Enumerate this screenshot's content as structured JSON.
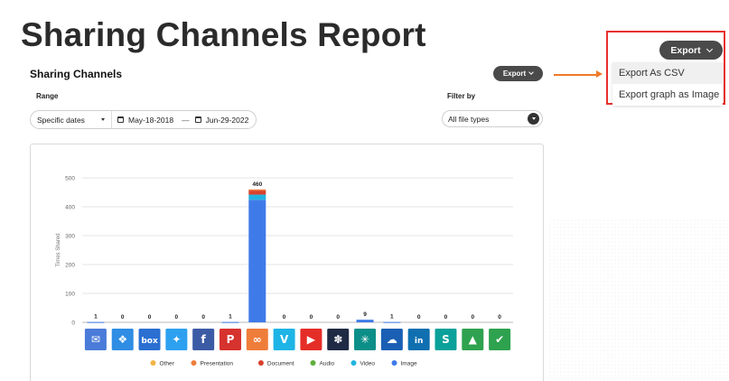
{
  "slide_title": "Sharing Channels Report",
  "panel": {
    "title": "Sharing Channels",
    "export_label": "Export",
    "range_label": "Range",
    "filter_label": "Filter by",
    "range_mode": "Specific dates",
    "start_date": "May-18-2018",
    "date_separator": "—",
    "end_date": "Jun-29-2022",
    "filter_value": "All file types"
  },
  "callout": {
    "export_label": "Export",
    "menu": [
      "Export As CSV",
      "Export graph as Image"
    ],
    "border_color": "#e8312c",
    "arrow_color": "#f07a2a"
  },
  "chart_data": {
    "type": "bar",
    "stacked": true,
    "ylabel": "Times Shared",
    "ylim": [
      0,
      500
    ],
    "yticks": [
      0,
      100,
      200,
      300,
      400,
      500
    ],
    "grid": true,
    "legend_position": "bottom",
    "categories": [
      "Email",
      "Dropbox",
      "Box",
      "Twitter",
      "Facebook",
      "Pinterest",
      "Link",
      "Vimeo",
      "YouTube",
      "Slack",
      "Flock",
      "OneDrive",
      "LinkedIn",
      "SharePoint",
      "Google Drive",
      "Approve"
    ],
    "totals": [
      1,
      0,
      0,
      0,
      0,
      1,
      460,
      0,
      0,
      0,
      9,
      1,
      0,
      0,
      0,
      0
    ],
    "series": [
      {
        "name": "Other",
        "color": "#f2b447",
        "values": [
          0,
          0,
          0,
          0,
          0,
          0,
          0,
          0,
          0,
          0,
          0,
          0,
          0,
          0,
          0,
          0
        ]
      },
      {
        "name": "Presentation",
        "color": "#ef7d3a",
        "values": [
          0,
          0,
          0,
          0,
          0,
          0,
          4,
          0,
          0,
          0,
          0,
          0,
          0,
          0,
          0,
          0
        ]
      },
      {
        "name": "Document",
        "color": "#d9412e",
        "values": [
          0,
          0,
          0,
          0,
          0,
          0,
          14,
          0,
          0,
          0,
          0,
          0,
          0,
          0,
          0,
          0
        ]
      },
      {
        "name": "Audio",
        "color": "#5fae3b",
        "values": [
          0,
          0,
          0,
          0,
          0,
          0,
          0,
          0,
          0,
          0,
          0,
          0,
          0,
          0,
          0,
          0
        ]
      },
      {
        "name": "Video",
        "color": "#22b3e0",
        "values": [
          0,
          0,
          0,
          0,
          0,
          0,
          18,
          0,
          0,
          0,
          0,
          0,
          0,
          0,
          0,
          0
        ]
      },
      {
        "name": "Image",
        "color": "#3f7be8",
        "values": [
          1,
          0,
          0,
          0,
          0,
          1,
          424,
          0,
          0,
          0,
          9,
          1,
          0,
          0,
          0,
          0
        ]
      }
    ],
    "icons": [
      {
        "name": "email-icon",
        "bg": "#4a7bd9",
        "glyph": "✉"
      },
      {
        "name": "dropbox-icon",
        "bg": "#2f8de4",
        "glyph": "❖"
      },
      {
        "name": "box-icon",
        "bg": "#2a6fd1",
        "glyph": "box"
      },
      {
        "name": "twitter-icon",
        "bg": "#2da1f0",
        "glyph": "✦"
      },
      {
        "name": "facebook-icon",
        "bg": "#3b5ba5",
        "glyph": "f"
      },
      {
        "name": "pinterest-icon",
        "bg": "#d6322e",
        "glyph": "P"
      },
      {
        "name": "link-icon",
        "bg": "#ef7d3a",
        "glyph": "∞"
      },
      {
        "name": "vimeo-icon",
        "bg": "#1eb4e6",
        "glyph": "V"
      },
      {
        "name": "youtube-icon",
        "bg": "#e52d27",
        "glyph": "▶"
      },
      {
        "name": "slack-icon",
        "bg": "#1f2a44",
        "glyph": "✽"
      },
      {
        "name": "flock-icon",
        "bg": "#0c8f88",
        "glyph": "✳"
      },
      {
        "name": "onedrive-icon",
        "bg": "#1a5fb4",
        "glyph": "☁"
      },
      {
        "name": "linkedin-icon",
        "bg": "#0f6fb0",
        "glyph": "in"
      },
      {
        "name": "sharepoint-icon",
        "bg": "#0aa19a",
        "glyph": "S"
      },
      {
        "name": "google-drive-icon",
        "bg": "#2ea24e",
        "glyph": "▲"
      },
      {
        "name": "approve-icon",
        "bg": "#2ea24e",
        "glyph": "✔"
      }
    ]
  }
}
